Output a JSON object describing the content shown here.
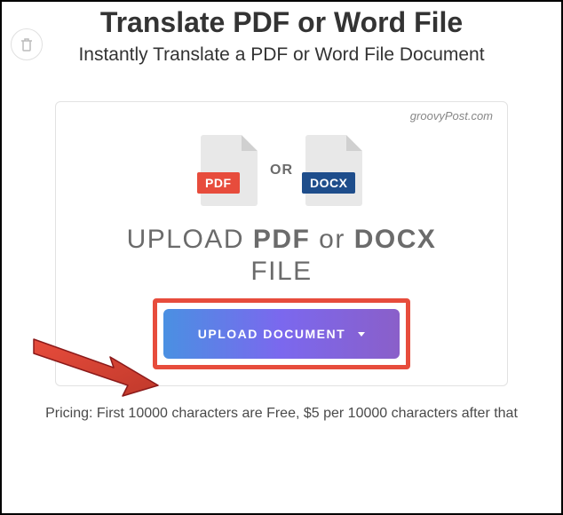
{
  "header": {
    "title": "Translate PDF or Word File",
    "subtitle": "Instantly Translate a PDF or Word File Document"
  },
  "card": {
    "watermark": "groovyPost.com",
    "pdf_label": "PDF",
    "or_label": "OR",
    "docx_label": "DOCX",
    "upload_prefix": "UPLOAD ",
    "upload_pdf": "PDF",
    "upload_or": " or ",
    "upload_docx": "DOCX",
    "upload_file": "FILE",
    "button_label": "UPLOAD DOCUMENT"
  },
  "pricing": "Pricing: First 10000 characters are Free, $5 per 10000 characters after that"
}
